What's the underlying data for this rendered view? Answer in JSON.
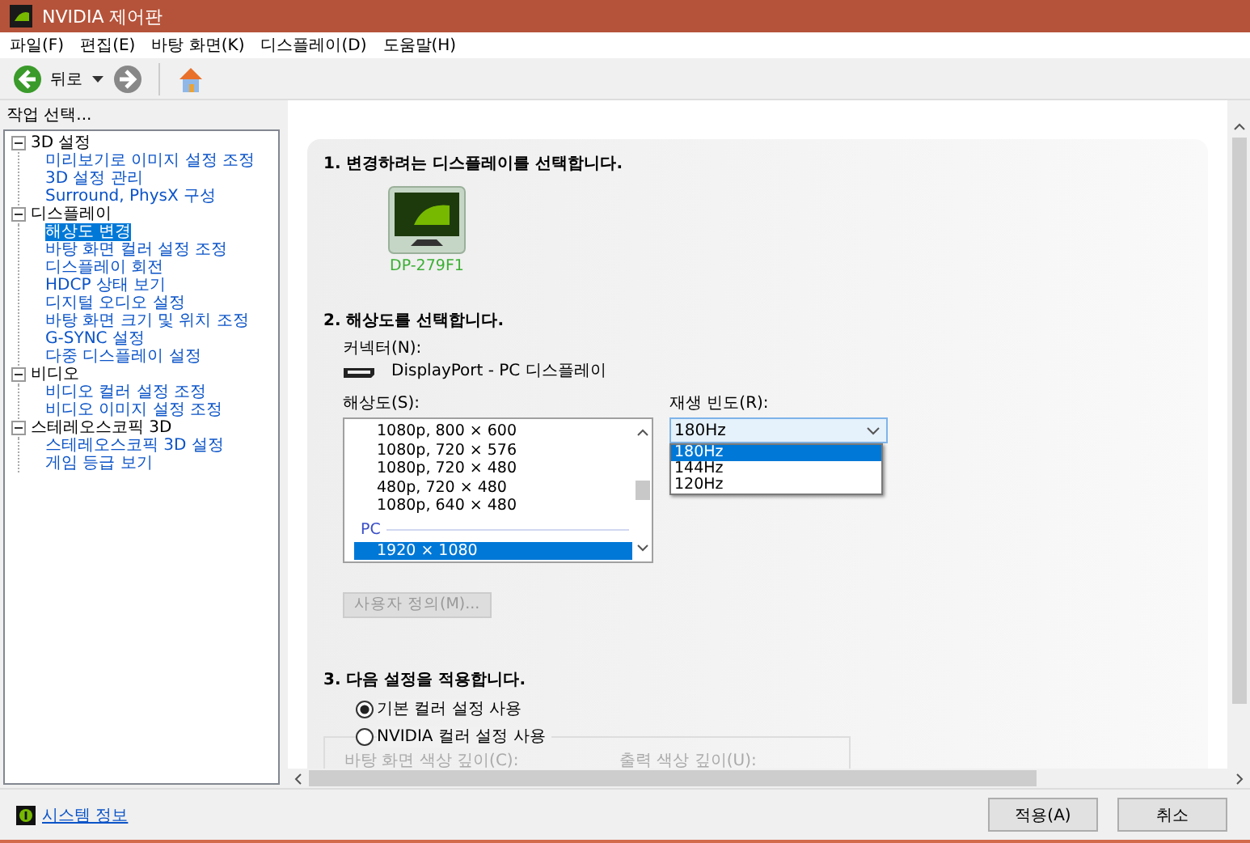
{
  "window": {
    "title": "NVIDIA 제어판"
  },
  "menu": [
    "파일(F)",
    "편집(E)",
    "바탕 화면(K)",
    "디스플레이(D)",
    "도움말(H)"
  ],
  "toolbar": {
    "back_label": "뒤로"
  },
  "sidebar": {
    "heading": "작업 선택...",
    "tree": [
      {
        "label": "3D 설정",
        "expanded": true,
        "children": [
          {
            "label": "미리보기로 이미지 설정 조정",
            "selected": false
          },
          {
            "label": "3D 설정 관리",
            "selected": false
          },
          {
            "label": "Surround, PhysX 구성",
            "selected": false
          }
        ]
      },
      {
        "label": "디스플레이",
        "expanded": true,
        "children": [
          {
            "label": "해상도 변경",
            "selected": true
          },
          {
            "label": "바탕 화면 컬러 설정 조정",
            "selected": false
          },
          {
            "label": "디스플레이 회전",
            "selected": false
          },
          {
            "label": "HDCP 상태 보기",
            "selected": false
          },
          {
            "label": "디지털 오디오 설정",
            "selected": false
          },
          {
            "label": "바탕 화면 크기 및 위치 조정",
            "selected": false
          },
          {
            "label": "G-SYNC 설정",
            "selected": false
          },
          {
            "label": "다중 디스플레이 설정",
            "selected": false
          }
        ]
      },
      {
        "label": "비디오",
        "expanded": true,
        "children": [
          {
            "label": "비디오 컬러 설정 조정",
            "selected": false
          },
          {
            "label": "비디오 이미지 설정 조정",
            "selected": false
          }
        ]
      },
      {
        "label": "스테레오스코픽 3D",
        "expanded": true,
        "children": [
          {
            "label": "스테레오스코픽 3D 설정",
            "selected": false
          },
          {
            "label": "게임 등급 보기",
            "selected": false
          }
        ]
      }
    ]
  },
  "section1": {
    "heading": "1. 변경하려는 디스플레이를 선택합니다.",
    "displays": [
      {
        "name": "DP-279F1",
        "selected": true
      }
    ]
  },
  "section2": {
    "heading": "2. 해상도를 선택합니다.",
    "connector_label": "커넥터(N):",
    "connector_value": "DisplayPort - PC 디스플레이",
    "resolution_label": "해상도(S):",
    "resolutions": [
      {
        "kind": "item",
        "label": "1080p, 800 × 600",
        "selected": false
      },
      {
        "kind": "item",
        "label": "1080p, 720 × 576",
        "selected": false
      },
      {
        "kind": "item",
        "label": "1080p, 720 × 480",
        "selected": false
      },
      {
        "kind": "item",
        "label": "480p, 720 × 480",
        "selected": false
      },
      {
        "kind": "item",
        "label": "1080p, 640 × 480",
        "selected": false
      },
      {
        "kind": "group",
        "label": "PC"
      },
      {
        "kind": "item",
        "label": "1920 × 1080",
        "selected": true
      }
    ],
    "refresh_label": "재생 빈도(R):",
    "refresh_value": "180Hz",
    "refresh_expanded": true,
    "refresh_options": [
      {
        "label": "180Hz",
        "selected": true
      },
      {
        "label": "144Hz",
        "selected": false
      },
      {
        "label": "120Hz",
        "selected": false
      }
    ],
    "custom_button": {
      "label": "사용자 정의(M)...",
      "disabled": true
    }
  },
  "section3": {
    "heading": "3. 다음 설정을 적용합니다.",
    "options": [
      {
        "label": "기본 컬러 설정 사용",
        "selected": true
      },
      {
        "label": "NVIDIA 컬러 설정 사용",
        "selected": false
      }
    ],
    "desktop_depth_label": "바탕 화면 색상 깊이(C):",
    "output_depth_label": "출력 색상 깊이(U):"
  },
  "footer": {
    "link": "시스템 정보",
    "buttons": [
      "적용(A)",
      "취소"
    ]
  }
}
